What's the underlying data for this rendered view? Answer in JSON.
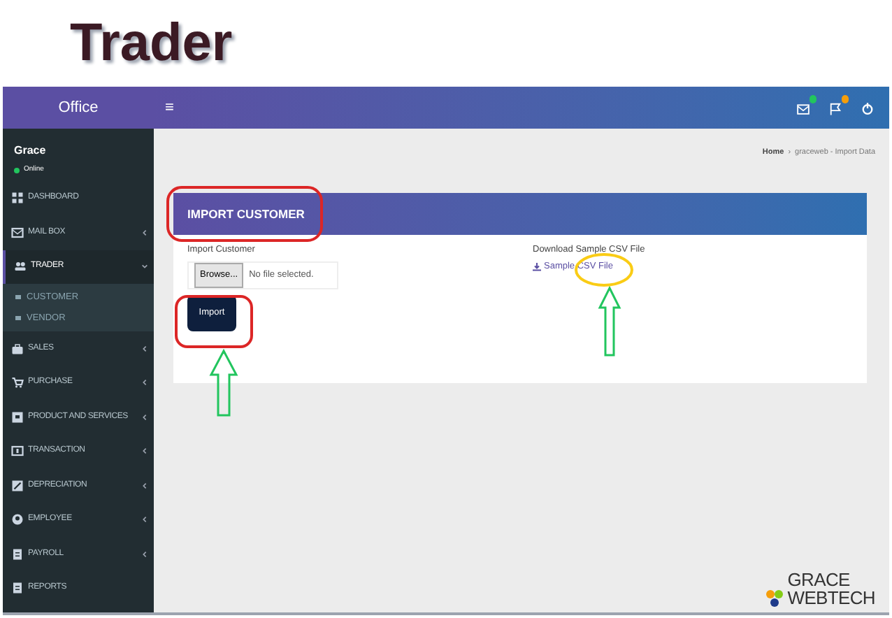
{
  "slide_title": "Trader",
  "app": {
    "brand": "Office",
    "menu_glyph": "≡",
    "header_icons": [
      {
        "kind": "mail",
        "color": "#22c55e"
      },
      {
        "kind": "flag",
        "color": "#f59e0b"
      },
      {
        "kind": "power"
      }
    ],
    "user": {
      "name": "Grace",
      "status": "Online"
    },
    "sidebar": [
      {
        "label": "DASHBOARD",
        "kind": "link",
        "selected": false
      },
      {
        "label": "MAIL BOX",
        "kind": "menu",
        "expanded": false,
        "selected": false
      },
      {
        "label": "TRADER",
        "kind": "menu",
        "expanded": true,
        "selected": true,
        "children": [
          {
            "label": "CUSTOMER"
          },
          {
            "label": "VENDOR"
          }
        ]
      },
      {
        "label": "SALES",
        "kind": "menu",
        "expanded": false,
        "selected": false
      },
      {
        "label": "PURCHASE",
        "kind": "menu",
        "expanded": false,
        "selected": false
      },
      {
        "label": "PRODUCT AND SERVICES",
        "kind": "menu",
        "expanded": false,
        "selected": false
      },
      {
        "label": "TRANSACTION",
        "kind": "menu",
        "expanded": false,
        "selected": false
      },
      {
        "label": "DEPRECIATION",
        "kind": "menu",
        "expanded": false,
        "selected": false
      },
      {
        "label": "EMPLOYEE",
        "kind": "menu",
        "expanded": false,
        "selected": false
      },
      {
        "label": "PAYROLL",
        "kind": "menu",
        "expanded": false,
        "selected": false
      },
      {
        "label": "REPORTS",
        "kind": "link",
        "selected": false
      }
    ],
    "breadcrumb": [
      "Home",
      "›",
      "graceweb - Import Data"
    ],
    "card": {
      "title": "IMPORT CUSTOMER",
      "field_label": "Import Customer",
      "browse": "Browse...",
      "file_status": "No file selected.",
      "submit": "Import",
      "download_label": "Download Sample CSV File",
      "download_link": "Sample CSV File"
    }
  },
  "logo": {
    "line_1": "GRACE",
    "line_2": "WEBTECH"
  }
}
